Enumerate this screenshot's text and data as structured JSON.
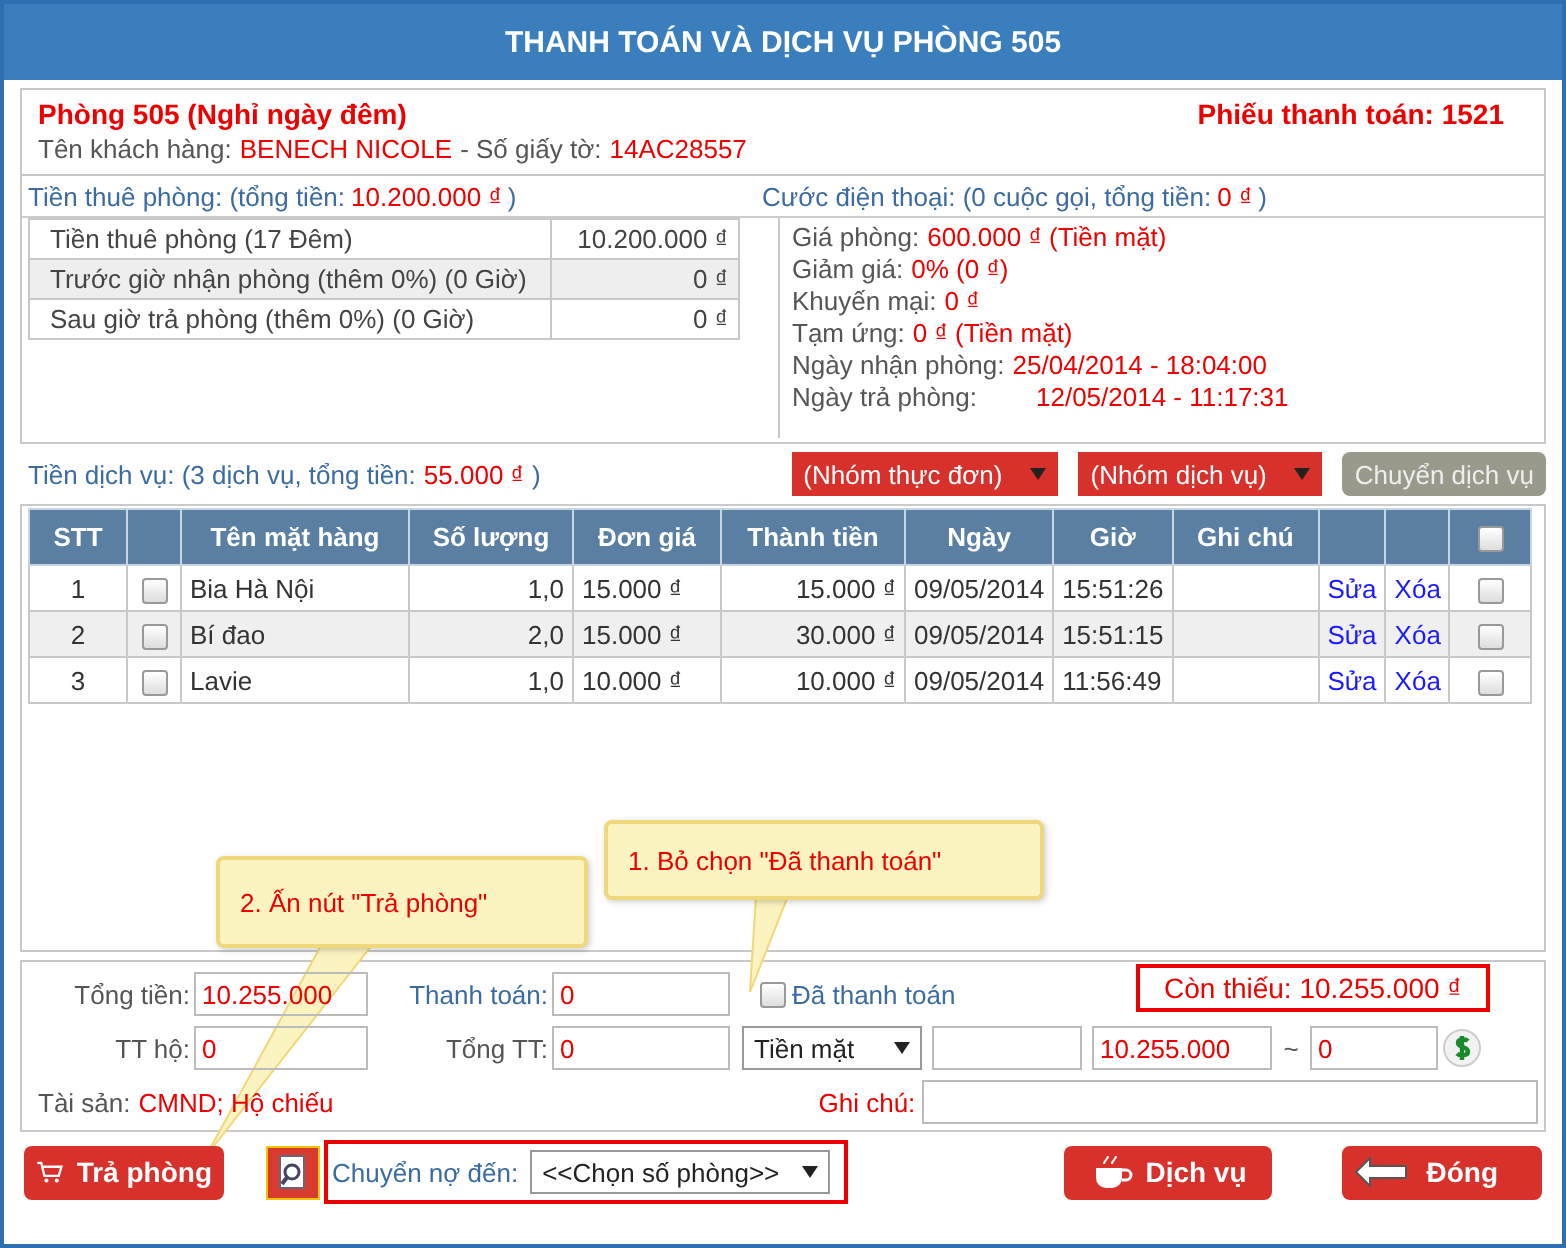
{
  "window": {
    "title": "THANH TOÁN VÀ DỊCH VỤ PHÒNG 505"
  },
  "header": {
    "room": "Phòng 505 (Nghỉ ngày đêm)",
    "invoice": "Phiếu thanh toán: 1521",
    "customer_label": "Tên khách hàng:",
    "customer_name": "BENECH NICOLE",
    "id_label": "- Số giấy tờ:",
    "id_value": "14AC28557"
  },
  "rent": {
    "label": "Tiền thuê phòng: (tổng tiền:",
    "total": "10.200.000 ₫",
    "close": ")",
    "rows": [
      {
        "label": "Tiền thuê phòng (17 Đêm)",
        "amount": "10.200.000 ₫"
      },
      {
        "label": "Trước giờ nhận phòng (thêm 0%) (0 Giờ)",
        "amount": "0 ₫"
      },
      {
        "label": "Sau giờ trả phòng (thêm 0%) (0 Giờ)",
        "amount": "0 ₫"
      }
    ]
  },
  "phone": {
    "label": "Cước điện thoại: (0 cuộc gọi, tổng tiền:",
    "total": "0 ₫",
    "close": ")",
    "info": [
      {
        "label": "Giá phòng:",
        "value": "600.000 ₫ (Tiền mặt)"
      },
      {
        "label": "Giảm giá:",
        "value": "0% (0 ₫)"
      },
      {
        "label": "Khuyến mại:",
        "value": "0 ₫"
      },
      {
        "label": "Tạm ứng:",
        "value": "0 ₫ (Tiền mặt)"
      },
      {
        "label": "Ngày nhận phòng:",
        "value": "25/04/2014 - 18:04:00"
      },
      {
        "label": "Ngày trả phòng:",
        "value": "12/05/2014 - 11:17:31"
      }
    ]
  },
  "services": {
    "label": "Tiền dịch vụ: (3 dịch vụ, tổng tiền:",
    "total": "55.000 ₫",
    "close": ")",
    "menu_group": "(Nhóm thực đơn)",
    "service_group": "(Nhóm dịch vụ)",
    "transfer_button": "Chuyển dịch vụ",
    "all_checked": false,
    "columns": [
      "STT",
      "Tên mặt hàng",
      "Số lượng",
      "Đơn giá",
      "Thành tiền",
      "Ngày",
      "Giờ",
      "Ghi chú"
    ],
    "rows": [
      {
        "stt": "1",
        "checked": false,
        "name": "Bia Hà Nội",
        "qty": "1,0",
        "price": "15.000 ₫",
        "amount": "15.000 ₫",
        "date": "09/05/2014",
        "time": "15:51:26",
        "edit": "Sửa",
        "delete": "Xóa",
        "selected": false
      },
      {
        "stt": "2",
        "checked": false,
        "name": "Bí đao",
        "qty": "2,0",
        "price": "15.000 ₫",
        "amount": "30.000 ₫",
        "date": "09/05/2014",
        "time": "15:51:15",
        "edit": "Sửa",
        "delete": "Xóa",
        "selected": false
      },
      {
        "stt": "3",
        "checked": false,
        "name": "Lavie",
        "qty": "1,0",
        "price": "10.000 ₫",
        "amount": "10.000 ₫",
        "date": "09/05/2014",
        "time": "11:56:49",
        "edit": "Sửa",
        "delete": "Xóa",
        "selected": false
      }
    ]
  },
  "summary": {
    "total_label": "Tổng tiền:",
    "total": "10.255.000",
    "paid_label": "Thanh toán:",
    "paid": "0",
    "paid_check_label": "Đã thanh toán",
    "paid_checked": false,
    "remaining": "Còn thiếu: 10.255.000 ₫",
    "proxy_label": "TT hộ:",
    "proxy": "0",
    "sum_label": "Tổng TT:",
    "sum": "0",
    "method": "Tiền mặt",
    "amount": "10.255.000",
    "tilde": "~",
    "change": "0",
    "assets_label": "Tài sản:",
    "assets": "CMND; Hộ chiếu",
    "note_label": "Ghi chú:"
  },
  "footer": {
    "checkout_button": "Trả phòng",
    "debt_label": "Chuyển nợ đến:",
    "debt_select": "<<Chọn số phòng>>",
    "service_button": "Dịch vụ",
    "close_button": "Đóng"
  },
  "callouts": [
    "1. Bỏ chọn \"Đã thanh toán\"",
    "2. Ấn nút \"Trả phòng\""
  ]
}
